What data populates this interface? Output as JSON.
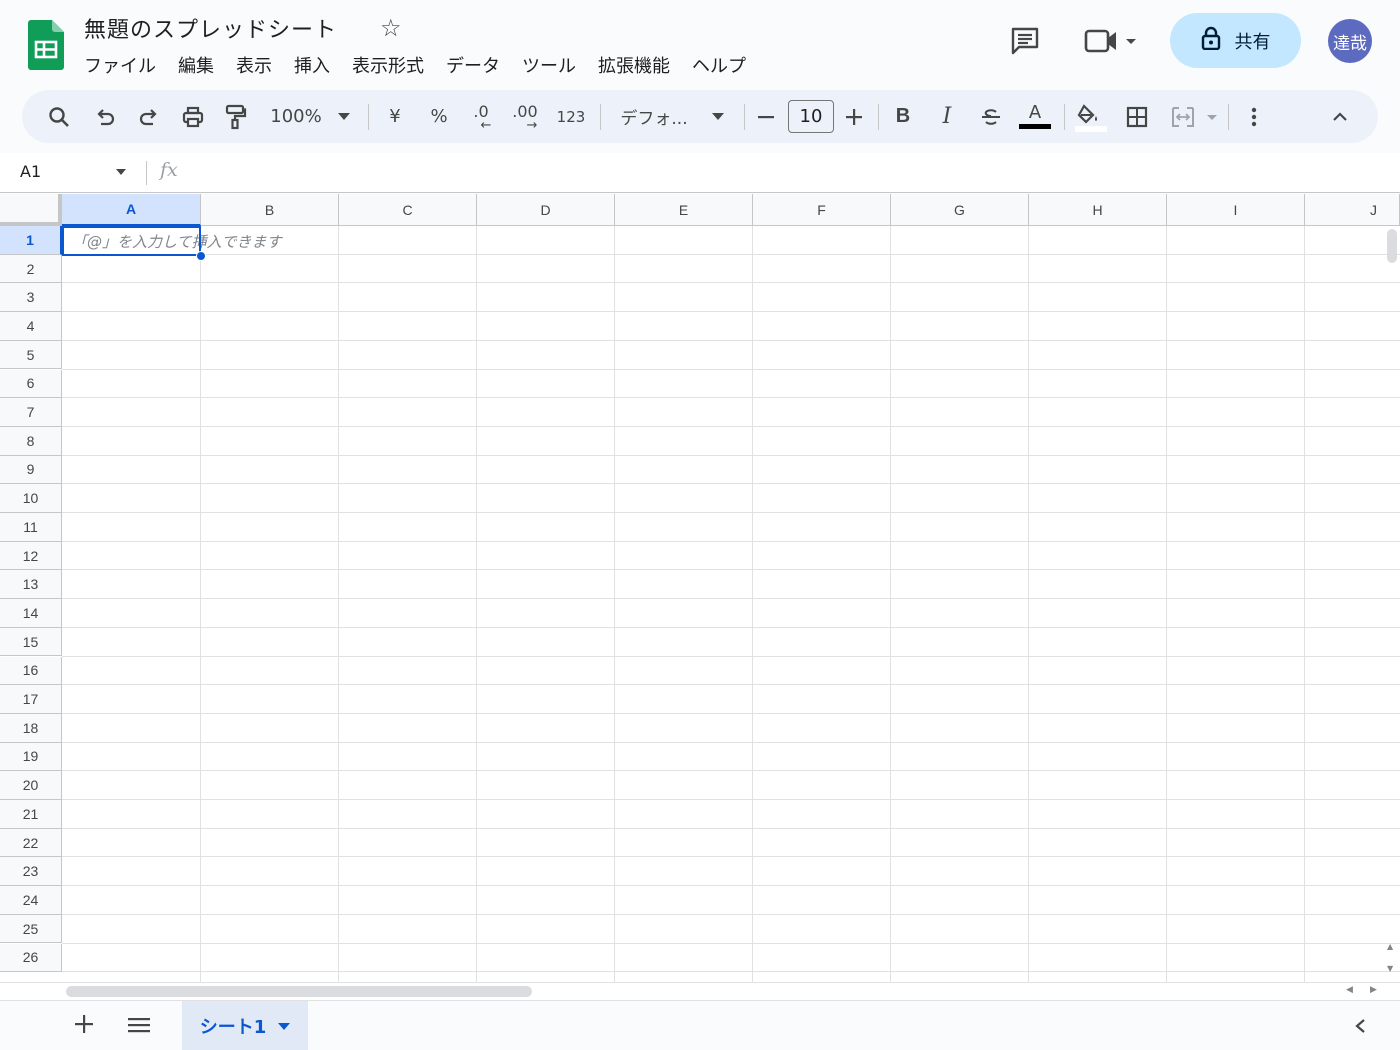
{
  "app": {
    "title": "無題のスプレッドシート",
    "menu": [
      "ファイル",
      "編集",
      "表示",
      "挿入",
      "表示形式",
      "データ",
      "ツール",
      "拡張機能",
      "ヘルプ"
    ],
    "share_label": "共有",
    "avatar_text": "達哉"
  },
  "toolbar": {
    "zoom": "100%",
    "currency": "¥",
    "percent": "%",
    "dec_decrease": ".0",
    "dec_increase": ".00",
    "number_format": "123",
    "font": "デフォ...",
    "font_size": "10",
    "bold": "B",
    "italic": "I",
    "text_color_letter": "A"
  },
  "formula_bar": {
    "cell_ref": "A1",
    "fx": "fx"
  },
  "grid": {
    "columns": [
      "A",
      "B",
      "C",
      "D",
      "E",
      "F",
      "G",
      "H",
      "I",
      "J"
    ],
    "rows": [
      "1",
      "2",
      "3",
      "4",
      "5",
      "6",
      "7",
      "8",
      "9",
      "10",
      "11",
      "12",
      "13",
      "14",
      "15",
      "16",
      "17",
      "18",
      "19",
      "20",
      "21",
      "22",
      "23",
      "24",
      "25",
      "26"
    ],
    "selected_cell": "A1",
    "cell_hint": "「@」を入力して挿入できます"
  },
  "sheets": {
    "tabs": [
      "シート1"
    ]
  },
  "colors": {
    "accent": "#0b57d0",
    "share_bg": "#c2e7ff",
    "logo": "#0f9d58"
  }
}
